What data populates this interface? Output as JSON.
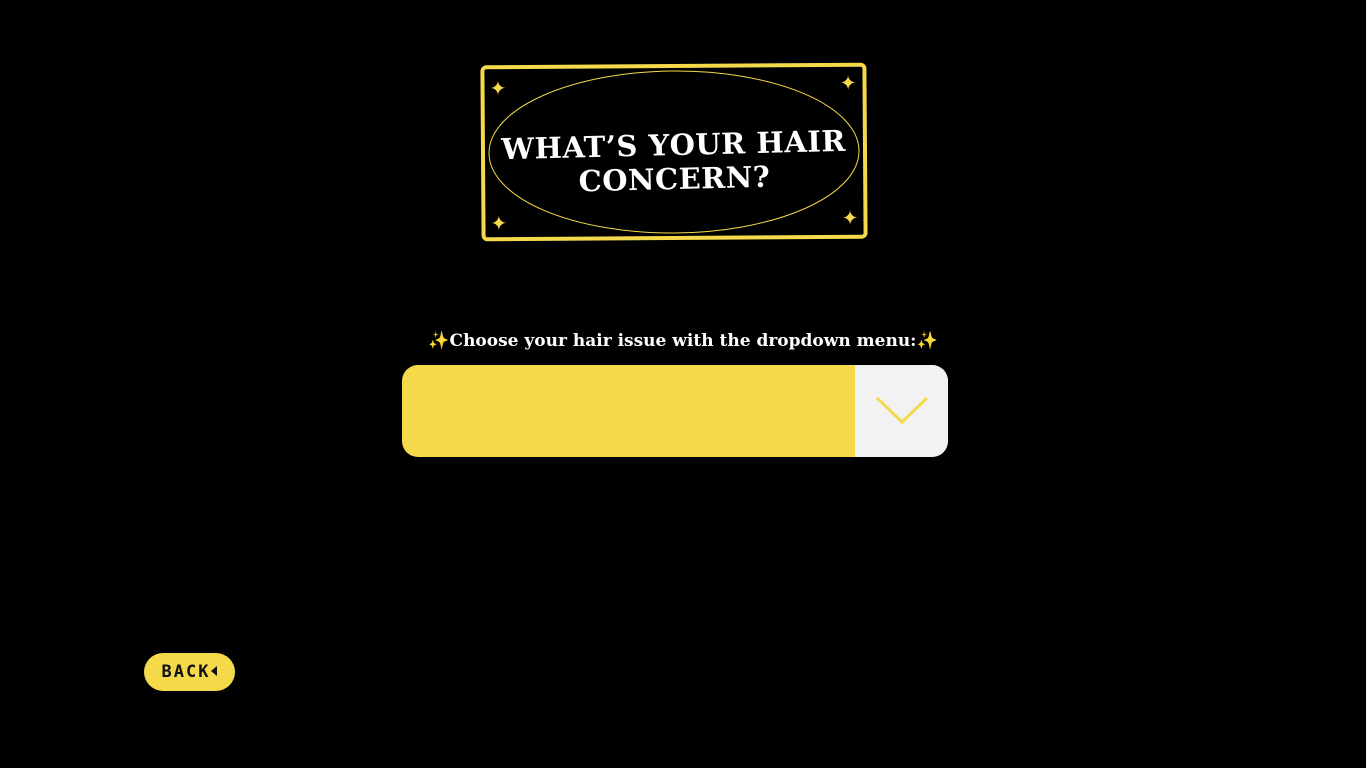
{
  "title": {
    "line1": "WHAT’S YOUR HAIR",
    "line2": "CONCERN?"
  },
  "prompt": {
    "spark_left": "✨",
    "text": "Choose your hair issue with the dropdown menu:",
    "spark_right": "✨"
  },
  "dropdown": {
    "selected_value": "",
    "arrow_icon": "chevron-down-icon"
  },
  "back_button": {
    "label": "BACK",
    "icon": "caret-left-icon"
  },
  "colors": {
    "background": "#000000",
    "accent": "#f4da4a",
    "arrow_box": "#f2f2f2",
    "text": "#ffffff"
  },
  "sparkle_icon": "sparkle-icon"
}
